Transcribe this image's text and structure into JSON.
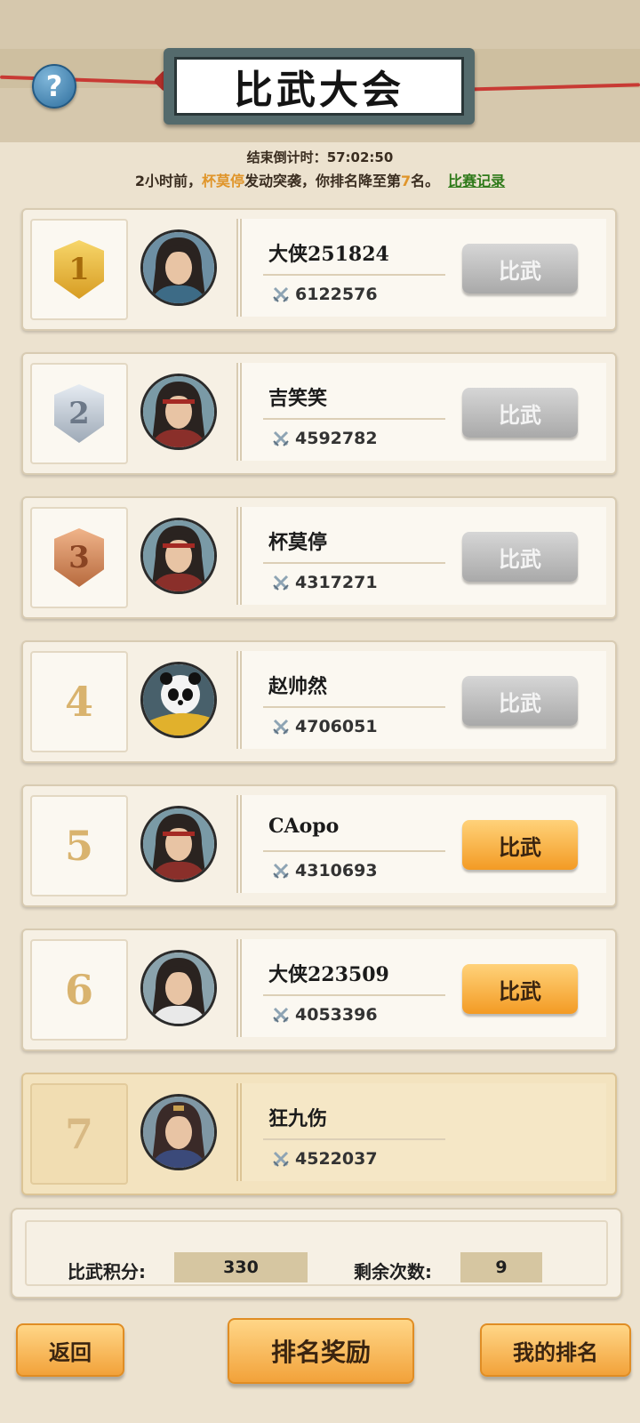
{
  "header": {
    "title": "比武大会",
    "help_symbol": "?"
  },
  "countdown": {
    "label": "结束倒计时：",
    "value": "57:02:50"
  },
  "notice": {
    "pre": "2小时前，",
    "name": "杯莫停",
    "mid": "发动突袭，你排名降至第",
    "rank": "7",
    "post": "名。",
    "link": "比赛记录"
  },
  "rows": [
    {
      "rank": "1",
      "name": "大侠251824",
      "power": "6122576",
      "button": "比武",
      "button_state": "disabled",
      "avatar_icon": "swordsman-topknot-icon"
    },
    {
      "rank": "2",
      "name": "吉笑笑",
      "power": "4592782",
      "button": "比武",
      "button_state": "disabled",
      "avatar_icon": "headband-warrior-icon"
    },
    {
      "rank": "3",
      "name": "杯莫停",
      "power": "4317271",
      "button": "比武",
      "button_state": "disabled",
      "avatar_icon": "headband-warrior-icon"
    },
    {
      "rank": "4",
      "name": "赵帅然",
      "power": "4706051",
      "button": "比武",
      "button_state": "disabled",
      "avatar_icon": "panda-icon"
    },
    {
      "rank": "5",
      "name": "CAopo",
      "power": "4310693",
      "button": "比武",
      "button_state": "active",
      "avatar_icon": "headband-warrior-icon"
    },
    {
      "rank": "6",
      "name": "大侠223509",
      "power": "4053396",
      "button": "比武",
      "button_state": "active",
      "avatar_icon": "scholar-swordsman-icon"
    },
    {
      "rank": "7",
      "name": "狂九伤",
      "power": "4522037",
      "button": "",
      "button_state": "self",
      "avatar_icon": "female-warrior-icon"
    }
  ],
  "stats": {
    "points_label": "比武积分:",
    "points_value": "330",
    "remaining_label": "剩余次数:",
    "remaining_value": "9"
  },
  "bottom": {
    "back": "返回",
    "rank_reward": "排名奖励",
    "my_rank": "我的排名"
  },
  "colors": {
    "button_active": "#f39b24",
    "button_disabled": "#a9a9a9",
    "highlight_name": "#e0952a",
    "link_green": "#2f7a1a"
  }
}
